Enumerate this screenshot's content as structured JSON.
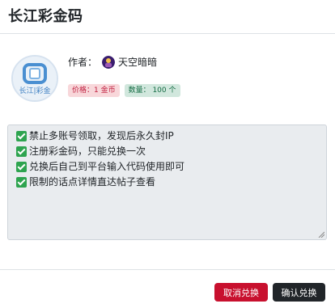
{
  "modal": {
    "title": "长江彩金码"
  },
  "logo": {
    "text": "长江|彩金"
  },
  "author": {
    "label": "作者：",
    "name": "天空暗暗"
  },
  "badges": {
    "price": "价格：1 金币",
    "quantity": "数量： 100 个"
  },
  "notes": [
    "禁止多账号领取，发现后永久封IP",
    "注册彩金码，只能兑换一次",
    "兑换后自己到平台输入代码使用即可",
    "限制的话点详情直达帖子查看"
  ],
  "buttons": {
    "cancel": "取消兑换",
    "confirm": "确认兑换"
  },
  "colors": {
    "cancel": "#c8102e",
    "confirm": "#212529",
    "check": "#2ea44f"
  }
}
